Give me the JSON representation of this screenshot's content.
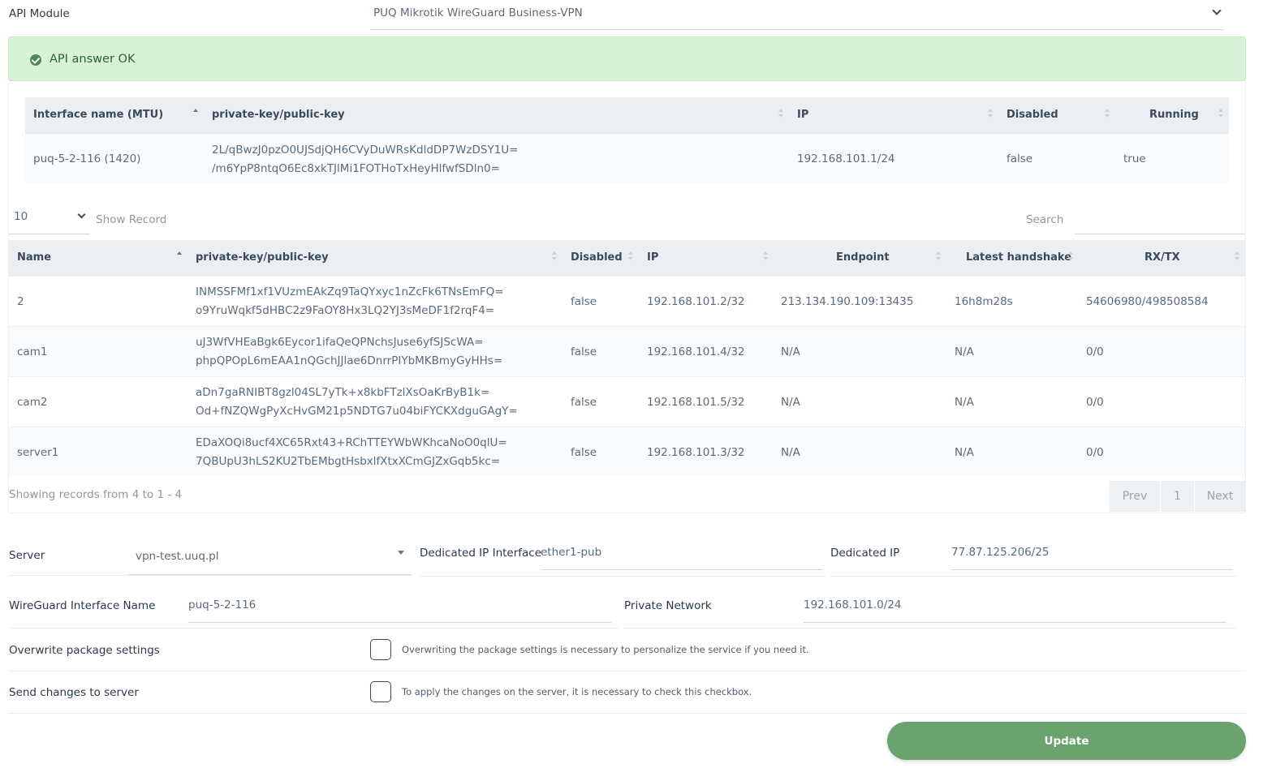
{
  "api_module": {
    "label": "API Module",
    "selected": "PUQ Mikrotik WireGuard Business-VPN"
  },
  "alert": {
    "text": "API answer OK",
    "color": "#d8f2d8"
  },
  "interface_table": {
    "headers": [
      "Interface name (MTU)",
      "private-key/public-key",
      "IP",
      "Disabled",
      "Running"
    ],
    "rows": [
      {
        "name": "puq-5-2-116 (1420)",
        "private_key": "2L/qBwzJ0pzO0UJSdjQH6CVyDuWRsKdldDP7WzDSY1U=",
        "public_key": "/m6YpP8ntqO6Ec8xkTJlMi1FOTHoTxHeyHlfwfSDln0=",
        "ip": "192.168.101.1/24",
        "disabled": "false",
        "running": "true"
      }
    ]
  },
  "table_controls": {
    "page_size": "10",
    "show_record_label": "Show Record",
    "search_label": "Search",
    "search_value": ""
  },
  "peers_table": {
    "headers": [
      "Name",
      "private-key/public-key",
      "Disabled",
      "IP",
      "Endpoint",
      "Latest handshake",
      "RX/TX"
    ],
    "rows": [
      {
        "name": "2",
        "private_key": "INMSSFMf1xf1VUzmEAkZq9TaQYxyc1nZcFk6TNsEmFQ=",
        "public_key": "o9YruWqkf5dHBC2z9FaOY8Hx3LQ2YJ3sMeDF1f2rqF4=",
        "disabled": "false",
        "ip": "192.168.101.2/32",
        "endpoint": "213.134.190.109:13435",
        "handshake": "16h8m28s",
        "rxtx": "54606980/498508584"
      },
      {
        "name": "cam1",
        "private_key": "uJ3WfVHEaBgk6Eycor1ifaQeQPNchsJuse6yfSJScWA=",
        "public_key": "phpQPOpL6mEAA1nQGchJJlae6DnrrPIYbMKBmyGyHHs=",
        "disabled": "false",
        "ip": "192.168.101.4/32",
        "endpoint": "N/A",
        "handshake": "N/A",
        "rxtx": "0/0"
      },
      {
        "name": "cam2",
        "private_key": "aDn7gaRNIBT8gzl04SL7yTk+x8kbFTzlXsOaKrByB1k=",
        "public_key": "Od+fNZQWgPyXcHvGM21p5NDTG7u04biFYCKXdguGAgY=",
        "disabled": "false",
        "ip": "192.168.101.5/32",
        "endpoint": "N/A",
        "handshake": "N/A",
        "rxtx": "0/0"
      },
      {
        "name": "server1",
        "private_key": "EDaXOQi8ucf4XC65Rxt43+RChTTEYWbWKhcaNoO0qlU=",
        "public_key": "7QBUpU3hLS2KU2TbEMbgtHsbxlfXtxXCmGJZxGqb5kc=",
        "disabled": "false",
        "ip": "192.168.101.3/32",
        "endpoint": "N/A",
        "handshake": "N/A",
        "rxtx": "0/0"
      }
    ],
    "records_info": "Showing records from 4 to 1 - 4",
    "pager": {
      "prev": "Prev",
      "page": "1",
      "next": "Next"
    }
  },
  "form": {
    "server_label": "Server",
    "server_value": "vpn-test.uuq.pl",
    "dedicated_iface_label": "Dedicated IP Interface",
    "dedicated_iface_value": "ether1-pub",
    "dedicated_ip_label": "Dedicated IP",
    "dedicated_ip_value": "77.87.125.206/25",
    "wg_iface_label": "WireGuard Interface Name",
    "wg_iface_value": "puq-5-2-116",
    "private_network_label": "Private Network",
    "private_network_value": "192.168.101.0/24",
    "overwrite_label": "Overwrite package settings",
    "overwrite_hint": "Overwriting the package settings is necessary to personalize the service if you need it.",
    "send_label": "Send changes to server",
    "send_hint": "To apply the changes on the server, it is necessary to check this checkbox."
  },
  "update_button": {
    "label": "Update",
    "color": "#6ba26d"
  }
}
